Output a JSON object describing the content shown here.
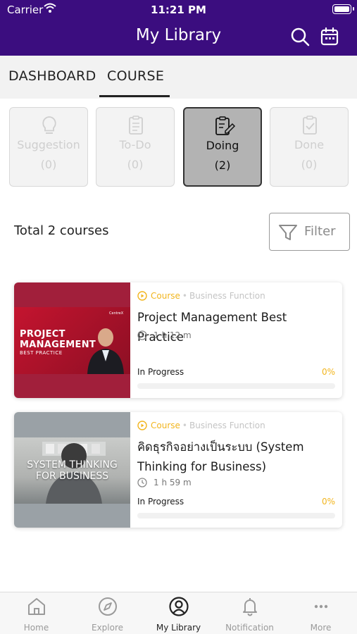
{
  "status_bar": {
    "carrier": "Carrier",
    "time": "11:21 PM"
  },
  "header": {
    "title": "My Library",
    "search_icon": "search-icon",
    "calendar_icon": "calendar-icon",
    "bg_color": "#3b0d7f"
  },
  "tabs": [
    {
      "label": "DASHBOARD",
      "active": false
    },
    {
      "label": "COURSE",
      "active": true
    }
  ],
  "status_filters": [
    {
      "label": "Suggestion",
      "count": "(0)",
      "icon": "lightbulb-icon",
      "active": false
    },
    {
      "label": "To-Do",
      "count": "(0)",
      "icon": "clipboard-icon",
      "active": false
    },
    {
      "label": "Doing",
      "count": "(2)",
      "icon": "clipboard-pen-icon",
      "active": true
    },
    {
      "label": "Done",
      "count": "(0)",
      "icon": "clipboard-check-icon",
      "active": false
    }
  ],
  "summary": {
    "total": "Total 2 courses",
    "filter_label": "Filter"
  },
  "courses": [
    {
      "type": "Course",
      "category": "Business Function",
      "title": "Project Management Best Practice",
      "duration": "1 h 12 m",
      "status": "In Progress",
      "progress_pct": "0%",
      "progress": 0,
      "thumb": {
        "line1": "PROJECT",
        "line2": "MANAGEMENT",
        "line3": "BEST PRACTICE",
        "brand": "CentreX"
      }
    },
    {
      "type": "Course",
      "category": "Business Function",
      "title": "คิดธุรกิจอย่างเป็นระบบ (System Thinking for Business)",
      "duration": "1 h 59 m",
      "status": "In Progress",
      "progress_pct": "0%",
      "progress": 0,
      "thumb": {
        "line1": "SYSTEM THINKING",
        "line2": "FOR BUSINESS"
      }
    }
  ],
  "nav": [
    {
      "label": "Home",
      "icon": "home-icon",
      "active": false
    },
    {
      "label": "Explore",
      "icon": "compass-icon",
      "active": false
    },
    {
      "label": "My Library",
      "icon": "user-circle-icon",
      "active": true
    },
    {
      "label": "Notification",
      "icon": "bell-icon",
      "active": false
    },
    {
      "label": "More",
      "icon": "more-dots-icon",
      "active": false
    }
  ],
  "colors": {
    "accent": "#f2b51e",
    "header": "#3b0d7f"
  }
}
